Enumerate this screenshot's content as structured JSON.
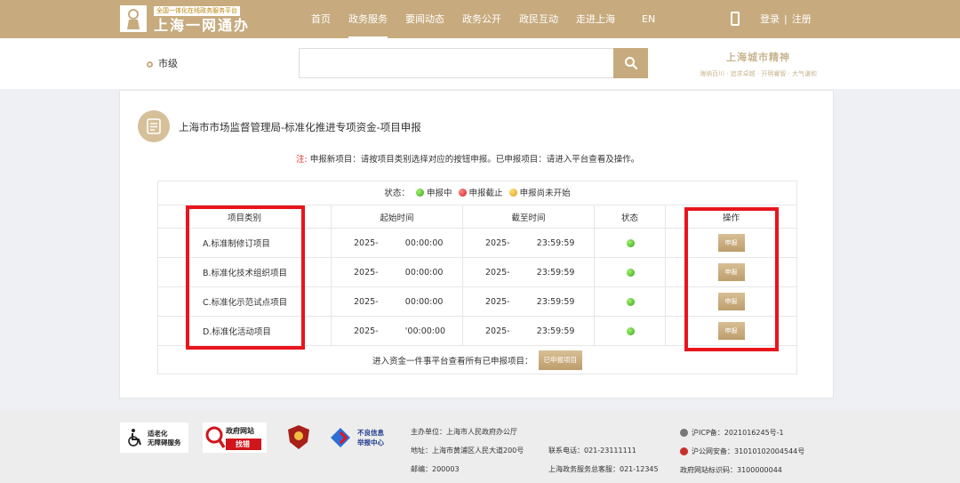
{
  "header": {
    "logo_tagline": "全国一体化在线政务服务平台",
    "logo_name": "上海一网通办",
    "nav": [
      "首页",
      "政务服务",
      "要闻动态",
      "政务公开",
      "政民互动",
      "走进上海"
    ],
    "lang": "EN",
    "login": "登录",
    "register": "注册",
    "auth_separator": "|"
  },
  "search": {
    "location": "市级",
    "placeholder": "",
    "spirit_title": "上海城市精神",
    "spirit_sub": "海纳百川 · 追求卓越 · 开明睿智 · 大气谦和"
  },
  "card": {
    "title": "上海市市场监督管理局-标准化推进专项资金-项目申报",
    "note_prefix": "注:",
    "note_text": "申报新项目：请按项目类别选择对应的按钮申报。已申报项目：请进入平台查看及操作。",
    "legend": {
      "label": "状态：",
      "open": "申报中",
      "closed": "申报截止",
      "pending": "申报尚未开始"
    },
    "columns": [
      "项目类别",
      "起始时间",
      "截至时间",
      "状态",
      "操作"
    ],
    "rows": [
      {
        "category": "A.标准制修订项目",
        "start": "2025-          00:00:00",
        "end": "2025-          23:59:59",
        "status": "green",
        "action": "申报"
      },
      {
        "category": "B.标准化技术组织项目",
        "start": "2025-          00:00:00",
        "end": "2025-          23:59:59",
        "status": "green",
        "action": "申报"
      },
      {
        "category": "C.标准化示范试点项目",
        "start": "2025-          00:00:00",
        "end": "2025-          23:59:59",
        "status": "green",
        "action": "申报"
      },
      {
        "category": "D.标准化活动项目",
        "start": "2025-          '00:00:00",
        "end": "2025-          23:59:59",
        "status": "green",
        "action": "申报"
      }
    ],
    "enter_text": "进入资金一件事平台查看所有已申报项目：",
    "enter_button": "已申报项目",
    "highlight_color": "#e8141e"
  },
  "footer": {
    "badge1": "适老化\n无障碍服务",
    "badge2_title": "政府网站",
    "badge2_sub": "找错",
    "badge4": "不良信息\n举报中心",
    "sponsor": "主办单位：上海市人民政府办公厅",
    "address": "地址：上海市黄浦区人民大道200号",
    "postcode": "邮编：200003",
    "phone": "联系电话：021-23111111",
    "hotline": "上海政务服务总客服：021-12345",
    "icp": "沪ICP备：2021016245号-1",
    "police": "沪公网安备：31010102004544号",
    "site_code": "政府网站标识码：3100000044"
  },
  "colors": {
    "brand": "#c7ab7e",
    "accent_red": "#e0201e"
  }
}
